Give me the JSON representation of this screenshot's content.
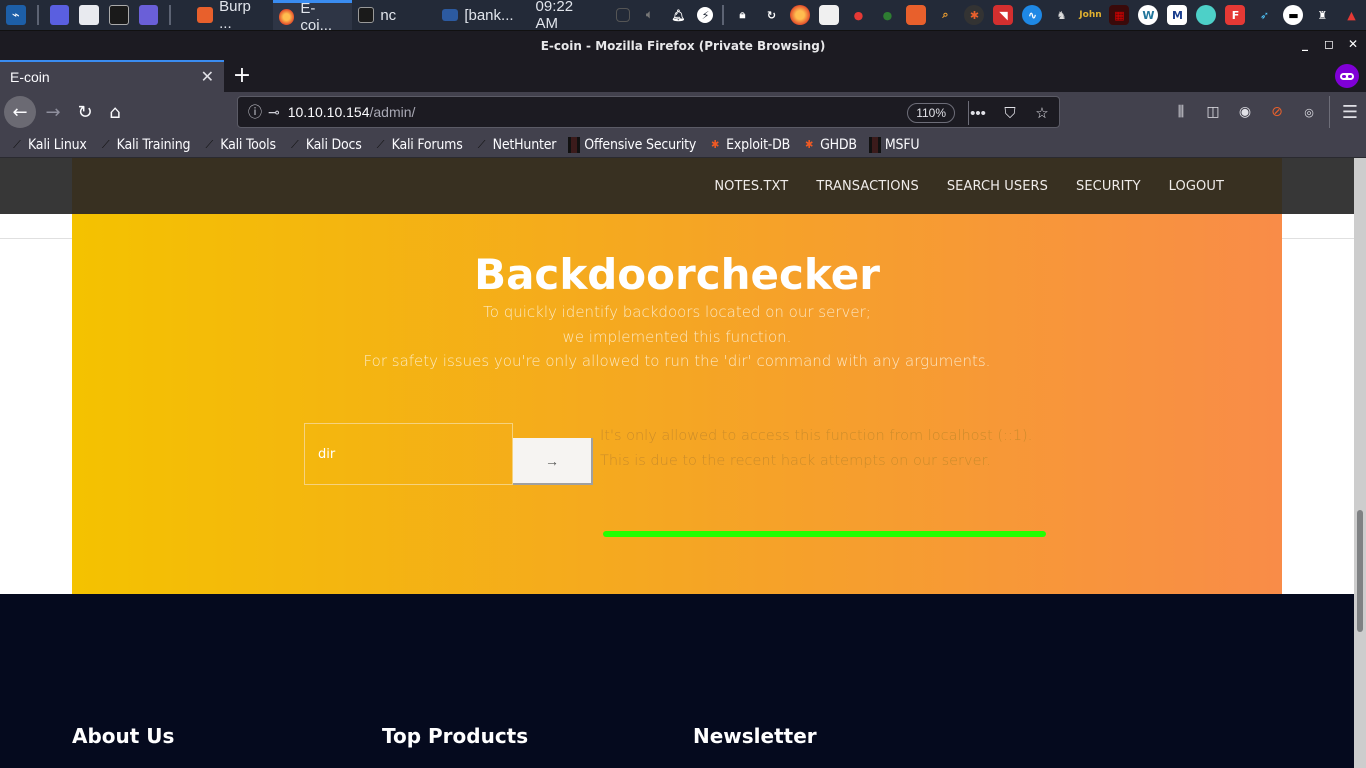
{
  "taskbar": {
    "tasks": [
      {
        "label": "Burp ...",
        "icon": "burp-icon",
        "active": false
      },
      {
        "label": "E-coi...",
        "icon": "firefox-icon",
        "active": true
      },
      {
        "label": "nc",
        "icon": "terminal-icon",
        "active": false
      },
      {
        "label": "[bank...",
        "icon": "folder-icon",
        "active": false
      }
    ],
    "clock": "09:22 AM",
    "tray_icons": [
      "lock-icon",
      "refresh-icon",
      "firefox-icon",
      "document-icon",
      "cherry-icon",
      "colors-icon",
      "burp-icon",
      "zaproxy-icon",
      "ant-icon",
      "kali-undercover-icon",
      "wireshark-icon",
      "dog-icon",
      "john-icon",
      "sqlmap-icon",
      "wordpress-icon",
      "metasploit-icon",
      "girl-icon",
      "flame-icon",
      "bird-icon",
      "hat-icon",
      "scorpion-icon",
      "thermometer-icon"
    ]
  },
  "window": {
    "title": "E-coin - Mozilla Firefox (Private Browsing)"
  },
  "tab": {
    "title": "E-coin"
  },
  "navbar": {
    "url_host": "10.10.10.154",
    "url_path": "/admin/",
    "zoom": "110%"
  },
  "bookmarks": [
    {
      "label": "Kali Linux",
      "icon": "kali-dragon-icon"
    },
    {
      "label": "Kali Training",
      "icon": "kali-dragon-icon"
    },
    {
      "label": "Kali Tools",
      "icon": "kali-dragon-icon"
    },
    {
      "label": "Kali Docs",
      "icon": "kali-dragon-icon"
    },
    {
      "label": "Kali Forums",
      "icon": "kali-dragon-icon"
    },
    {
      "label": "NetHunter",
      "icon": "kali-dragon-icon"
    },
    {
      "label": "Offensive Security",
      "icon": "offsec-icon"
    },
    {
      "label": "Exploit-DB",
      "icon": "exploitdb-bug-icon"
    },
    {
      "label": "GHDB",
      "icon": "exploitdb-bug-icon"
    },
    {
      "label": "MSFU",
      "icon": "offsec-icon"
    }
  ],
  "site": {
    "nav": [
      "NOTES.TXT",
      "TRANSACTIONS",
      "SEARCH USERS",
      "SECURITY",
      "LOGOUT"
    ],
    "hero": {
      "title": "Backdoorchecker",
      "subtitle_lines": [
        "To quickly identify backdoors located on our server;",
        "we implemented this function.",
        "For safety issues you're only allowed to run the 'dir' command with any arguments."
      ],
      "input_value": "dir",
      "submit_label": "→",
      "message_lines": [
        "It's only allowed to access this function from localhost (::1).",
        "This is due to the recent hack attempts on our server."
      ]
    },
    "footer": {
      "headings": [
        "About Us",
        "Top Products",
        "Newsletter"
      ]
    }
  },
  "colors": {
    "hero_gradient_start": "#f4c200",
    "hero_gradient_end": "#f98c48",
    "nav_bg": "#383021",
    "footer_bg": "#050a1e",
    "highlight_underline": "#22ff00",
    "private_badge": "#8000d7"
  }
}
